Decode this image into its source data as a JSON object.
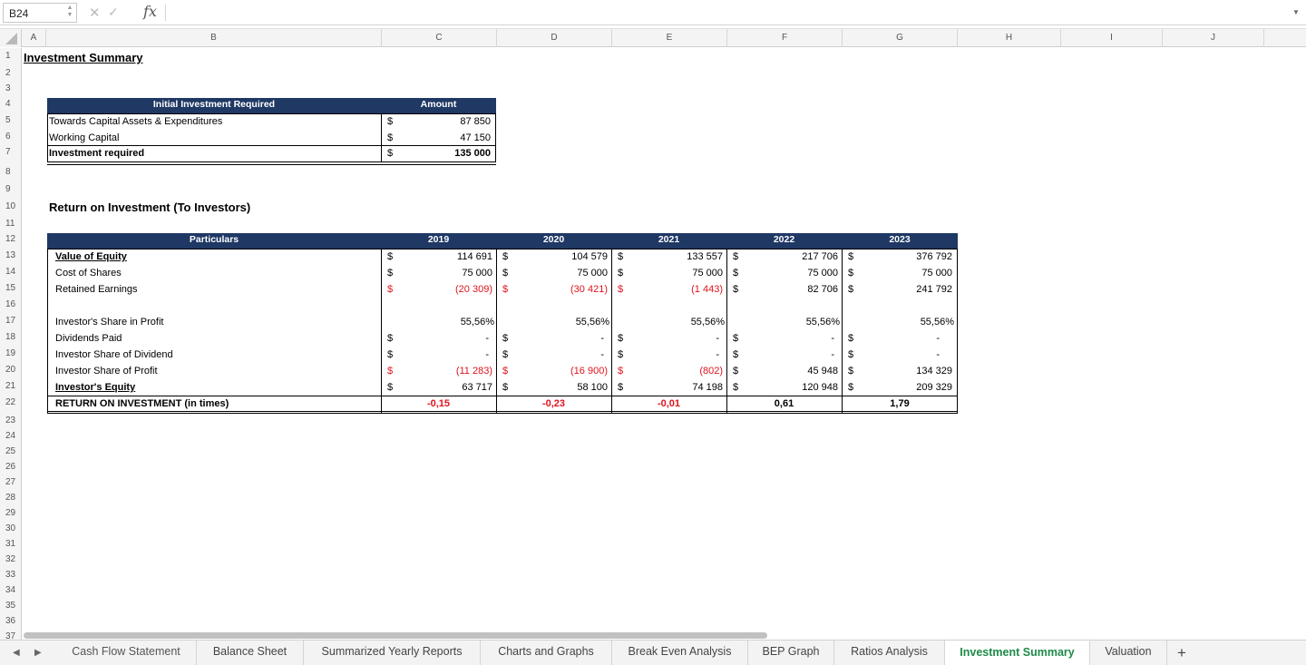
{
  "formula_bar": {
    "cell_ref": "B24",
    "formula": "",
    "fx": "fx"
  },
  "columns": [
    "A",
    "B",
    "C",
    "D",
    "E",
    "F",
    "G",
    "H",
    "I",
    "J"
  ],
  "rows": [
    "1",
    "2",
    "3",
    "4",
    "5",
    "6",
    "7",
    "8",
    "9",
    "10",
    "11",
    "12",
    "13",
    "14",
    "15",
    "16",
    "17",
    "18",
    "19",
    "20",
    "21",
    "22",
    "23",
    "24",
    "25",
    "26",
    "27",
    "28",
    "29",
    "30",
    "31",
    "32",
    "33",
    "34",
    "35",
    "36",
    "37"
  ],
  "title": "Investment Summary",
  "initial_investment": {
    "header_label": "Initial Investment Required",
    "header_amount": "Amount",
    "rows": [
      {
        "label": "Towards Capital Assets & Expenditures",
        "currency": "$",
        "amount": "87 850"
      },
      {
        "label": "Working Capital",
        "currency": "$",
        "amount": "47 150"
      },
      {
        "label": "Investment required",
        "currency": "$",
        "amount": "135 000"
      }
    ]
  },
  "roi_title": "Return on Investment (To Investors)",
  "roi": {
    "header_label": "Particulars",
    "years": [
      "2019",
      "2020",
      "2021",
      "2022",
      "2023"
    ],
    "rows": [
      {
        "label": "Value of Equity",
        "values": [
          "114 691",
          "104 579",
          "133 557",
          "217 706",
          "376 792"
        ]
      },
      {
        "label": "Cost of Shares",
        "values": [
          "75 000",
          "75 000",
          "75 000",
          "75 000",
          "75 000"
        ]
      },
      {
        "label": "Retained Earnings",
        "values": [
          "(20 309)",
          "(30 421)",
          "(1 443)",
          "82 706",
          "241 792"
        ]
      },
      {
        "label": "Investor's Share in Profit",
        "values": [
          "55,56%",
          "55,56%",
          "55,56%",
          "55,56%",
          "55,56%"
        ]
      },
      {
        "label": "Dividends Paid",
        "values": [
          "-",
          "-",
          "-",
          "-",
          "-"
        ]
      },
      {
        "label": "Investor Share of Dividend",
        "values": [
          "-",
          "-",
          "-",
          "-",
          "-"
        ]
      },
      {
        "label": "Investor Share of Profit",
        "values": [
          "(11 283)",
          "(16 900)",
          "(802)",
          "45 948",
          "134 329"
        ]
      },
      {
        "label": "Investor's Equity",
        "values": [
          "63 717",
          "58 100",
          "74 198",
          "120 948",
          "209 329"
        ]
      },
      {
        "label": "RETURN ON INVESTMENT (in times)",
        "values": [
          "-0,15",
          "-0,23",
          "-0,01",
          "0,61",
          "1,79"
        ]
      }
    ],
    "currency": "$"
  },
  "tabs": [
    "Cash Flow Statement",
    "Balance Sheet",
    "Summarized Yearly Reports",
    "Charts and Graphs",
    "Break Even Analysis",
    "BEP Graph",
    "Ratios Analysis",
    "Investment Summary",
    "Valuation"
  ],
  "active_tab": "Investment Summary",
  "add_sheet": "+"
}
